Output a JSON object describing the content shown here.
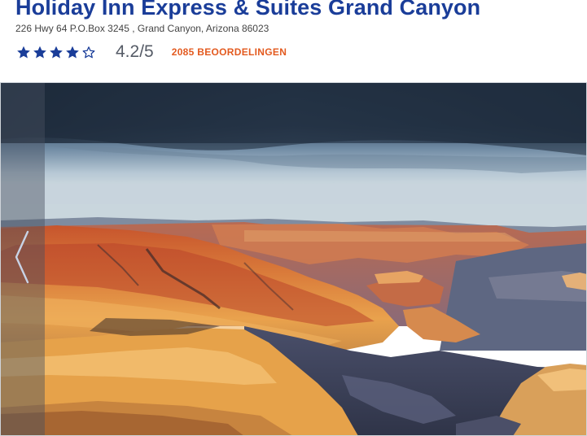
{
  "hotel": {
    "name": "Holiday Inn Express & Suites Grand Canyon",
    "address": "226 Hwy 64 P.O.Box 3245 , Grand Canyon, Arizona 86023"
  },
  "rating": {
    "stars_filled": 4,
    "stars_total": 5,
    "score_text": "4.2/5",
    "reviews_label": "2085 BEOORDELINGEN"
  },
  "gallery": {
    "image_subject": "grand canyon at sunset",
    "prev_icon": "chevron-left-icon"
  },
  "colors": {
    "title": "#1a3d99",
    "stars": "#1a3d99",
    "score": "#555b66",
    "reviews": "#e35a1f"
  }
}
